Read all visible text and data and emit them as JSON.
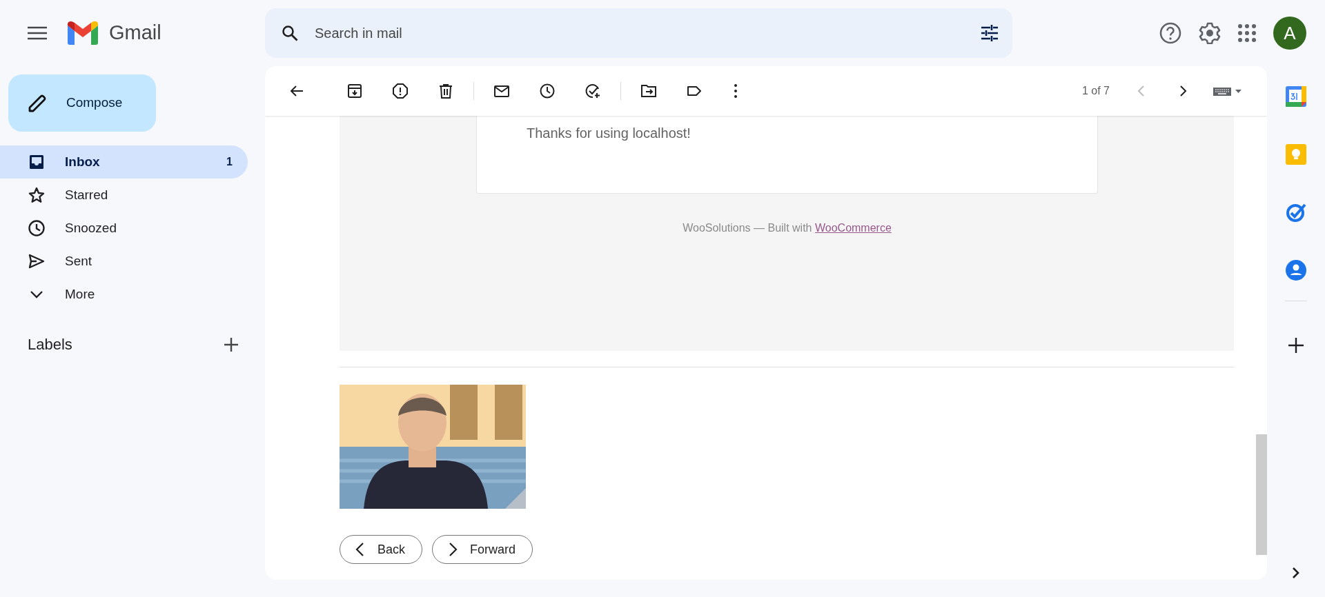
{
  "app": {
    "name": "Gmail"
  },
  "search": {
    "placeholder": "Search in mail"
  },
  "account": {
    "initial": "A"
  },
  "compose": {
    "label": "Compose"
  },
  "sidebar": {
    "items": [
      {
        "label": "Inbox",
        "count": "1",
        "selected": true
      },
      {
        "label": "Starred",
        "selected": false
      },
      {
        "label": "Snoozed",
        "selected": false
      },
      {
        "label": "Sent",
        "selected": false
      },
      {
        "label": "More",
        "selected": false
      }
    ]
  },
  "labels": {
    "heading": "Labels"
  },
  "toolbar": {
    "pager": "1 of 7",
    "prev_disabled": true
  },
  "message": {
    "body": "Thanks for using localhost!",
    "footer_text": "WooSolutions — Built with",
    "footer_link": "WooCommerce"
  },
  "actions": [
    {
      "label": "Back"
    },
    {
      "label": "Forward"
    }
  ]
}
